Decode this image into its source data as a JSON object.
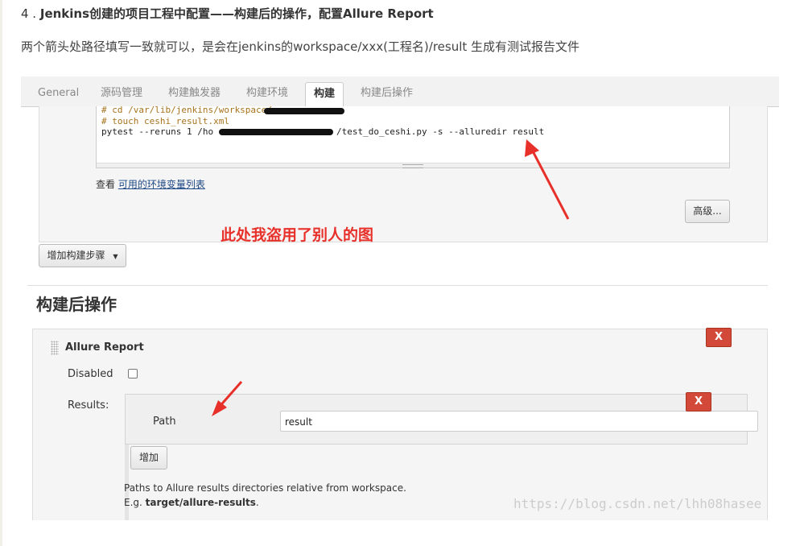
{
  "blog": {
    "heading_num": "4 . ",
    "heading_text": "Jenkins创建的项目工程中配置——构建后的操作，配置Allure Report",
    "paragraph": "两个箭头处路径填写一致就可以，是会在jenkins的workspace/xxx(工程名)/result 生成有测试报告文件",
    "watermark": "https://blog.csdn.net/lhh08hasee"
  },
  "tabs": [
    {
      "label": "General"
    },
    {
      "label": "源码管理"
    },
    {
      "label": "构建触发器"
    },
    {
      "label": "构建环境"
    },
    {
      "label": "构建"
    },
    {
      "label": "构建后操作"
    }
  ],
  "active_tab": "构建",
  "build": {
    "code_lines": [
      "# cd /var/lib/jenkins/workspace/",
      "# touch ceshi_result.xml",
      "pytest --reruns 1 /ho",
      "/test_do_ceshi.py -s --alluredir result"
    ],
    "env_prefix": "查看 ",
    "env_link": "可用的环境变量列表",
    "advanced_button": "高级...",
    "annotation": "此处我盗用了别人的图",
    "add_step_button": "增加构建步骤"
  },
  "post_build": {
    "title": "构建后操作",
    "plugin_title": "Allure Report",
    "delete_label": "X",
    "disabled_label": "Disabled",
    "results_label": "Results:",
    "path_label": "Path",
    "path_value": "result",
    "add_button": "增加",
    "help_line1": "Paths to Allure results directories relative from workspace.",
    "help_line2_prefix": "E.g. ",
    "help_line2_bold": "target/allure-results",
    "help_line2_suffix": "."
  },
  "colors": {
    "annotation_red": "#e8302a",
    "delete_red": "#d24939",
    "link_blue": "#204a87",
    "comment_brown": "#a8731b"
  }
}
